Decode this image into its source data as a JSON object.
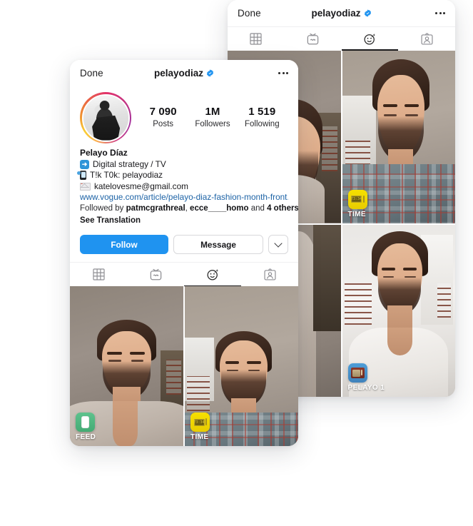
{
  "back_card": {
    "navbar": {
      "done_label": "Done",
      "title": "pelayodiaz",
      "verified_icon": "verified-badge-icon",
      "more_icon": "more-options-icon"
    },
    "tabs": [
      {
        "name": "grid",
        "icon": "grid-icon",
        "active": false
      },
      {
        "name": "igtv",
        "icon": "igtv-icon",
        "active": false
      },
      {
        "name": "effects",
        "icon": "effects-smiley-icon",
        "active": true
      },
      {
        "name": "tagged",
        "icon": "tagged-person-icon",
        "active": false
      }
    ],
    "grid": [
      {
        "badge_label": "",
        "badge_icon": "",
        "photo": "selfie-beige-wall-left"
      },
      {
        "badge_label": "TIME",
        "badge_icon": "time-tv-effect-icon",
        "photo": "selfie-plaid-shirt"
      },
      {
        "badge_label": "",
        "badge_icon": "",
        "photo": "selfie-partial-lower-left"
      },
      {
        "badge_label": "PELAYO 1",
        "badge_icon": "pelayo-tv-effect-icon",
        "photo": "selfie-white-tank-top"
      }
    ]
  },
  "front_card": {
    "navbar": {
      "done_label": "Done",
      "title": "pelayodiaz",
      "verified_icon": "verified-badge-icon",
      "more_icon": "more-options-icon"
    },
    "avatar": {
      "name": "profile-avatar",
      "ring_colors": [
        "#fbad50",
        "#f9ce34",
        "#ee8433",
        "#e1306c",
        "#c13584",
        "#a02d9c"
      ]
    },
    "stats": [
      {
        "value": "7 090",
        "label": "Posts"
      },
      {
        "value": "1M",
        "label": "Followers"
      },
      {
        "value": "1 519",
        "label": "Following"
      }
    ],
    "bio": {
      "display_name": "Pelayo Díaz",
      "lines": [
        {
          "emoji": "blue-arrow-emoji",
          "text": "Digital strategy / TV"
        },
        {
          "emoji": "mobile-phone-emoji",
          "text": "T!k T0k: pelayodiaz"
        },
        {
          "emoji": "envelope-emoji",
          "text": "katelovesme@gmail.com"
        }
      ],
      "link": "www.vogue.com/article/pelayo-diaz-fashion-month-front...",
      "followed_by_prefix": "Followed by ",
      "followed_by_users": [
        "patmcgrathreal",
        "ecce____homo"
      ],
      "followed_by_middle": ", ",
      "followed_by_join": " and ",
      "followed_by_others": "4 others",
      "see_translation": "See Translation"
    },
    "actions": {
      "follow_label": "Follow",
      "message_label": "Message",
      "caret_icon": "chevron-down-icon",
      "follow_color": "#1f93f0"
    },
    "tabs": [
      {
        "name": "grid",
        "icon": "grid-icon",
        "active": false
      },
      {
        "name": "igtv",
        "icon": "igtv-icon",
        "active": false
      },
      {
        "name": "effects",
        "icon": "effects-smiley-icon",
        "active": true
      },
      {
        "name": "tagged",
        "icon": "tagged-person-icon",
        "active": false
      }
    ],
    "grid": [
      {
        "badge_label": "FEED",
        "badge_icon": "feed-phone-effect-icon",
        "photo": "selfie-beige-blazer"
      },
      {
        "badge_label": "TIME",
        "badge_icon": "time-tv-effect-icon",
        "photo": "selfie-plaid-shirt"
      }
    ]
  }
}
